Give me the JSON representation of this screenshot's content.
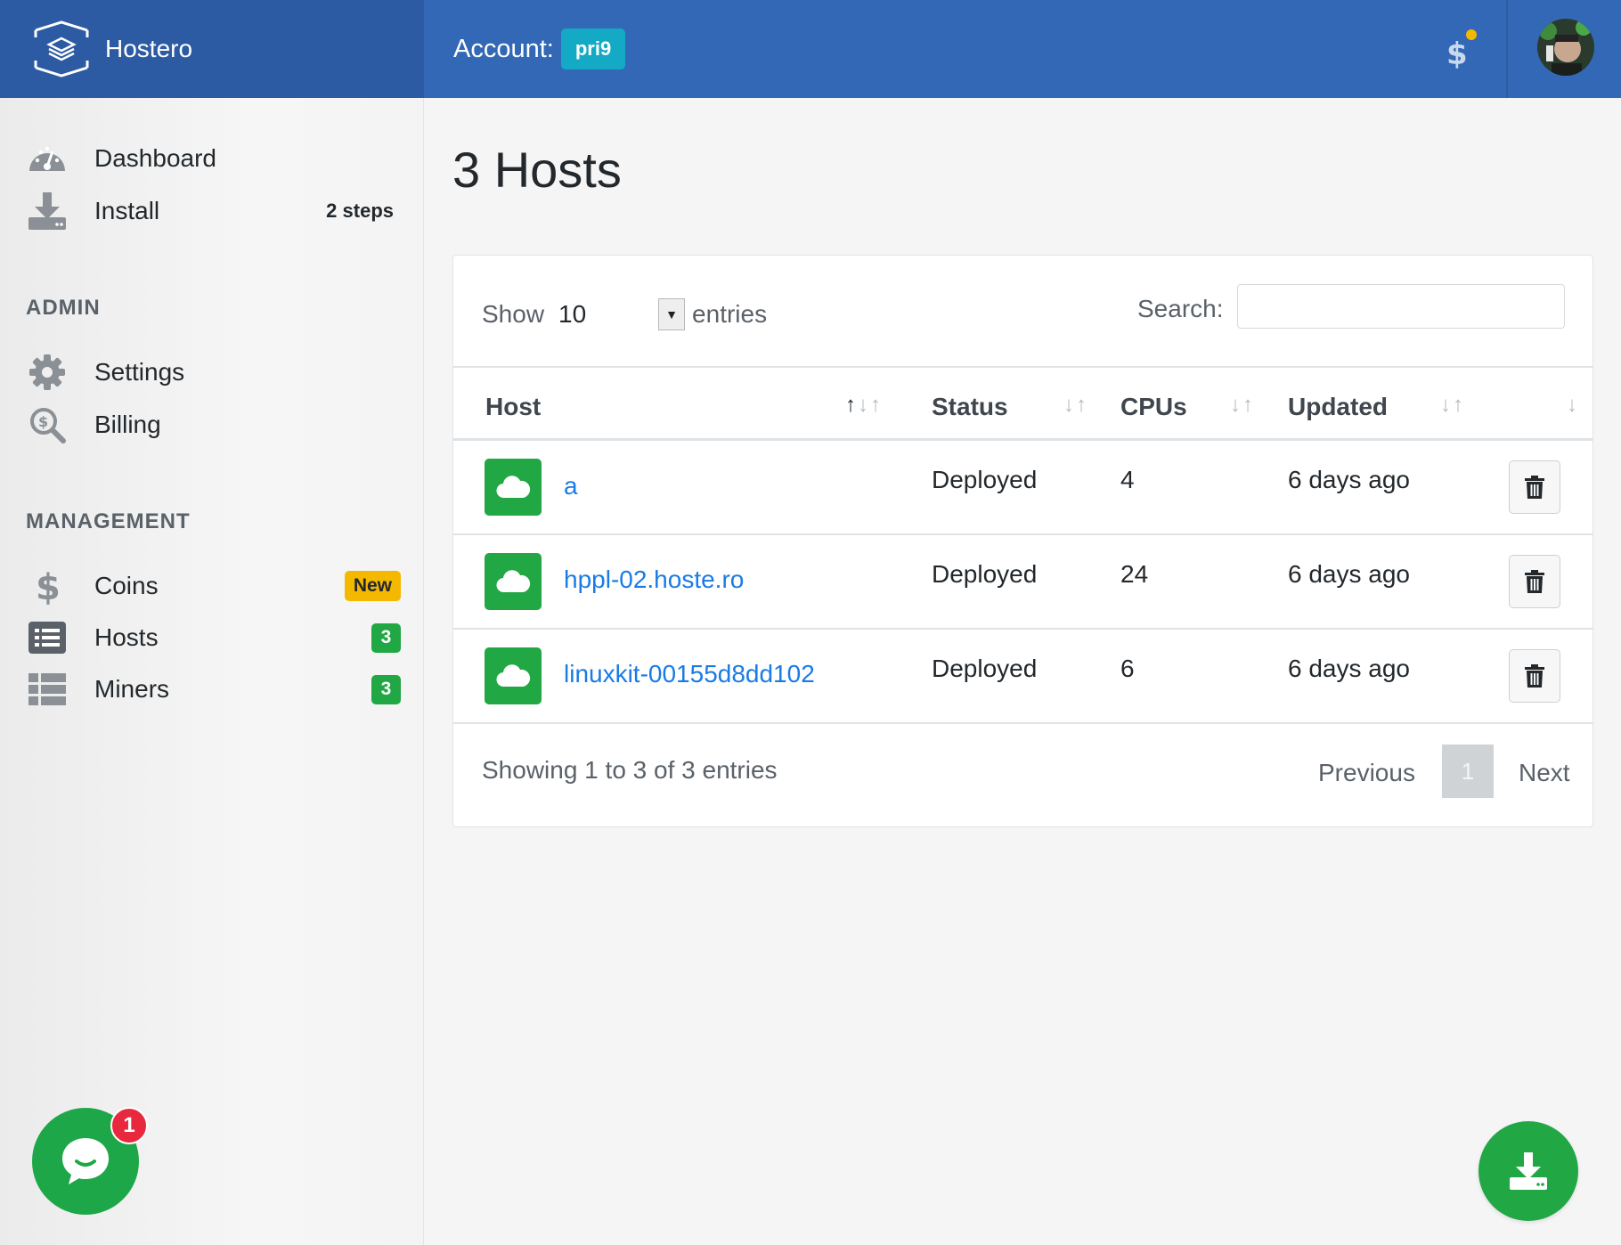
{
  "app": {
    "name": "Hostero"
  },
  "topbar": {
    "account_label": "Account:",
    "account_name": "pri9"
  },
  "sidebar": {
    "items": [
      {
        "label": "Dashboard",
        "icon": "dashboard-icon"
      },
      {
        "label": "Install",
        "icon": "download-icon",
        "extra": "2 steps"
      }
    ],
    "admin": {
      "title": "ADMIN",
      "items": [
        {
          "label": "Settings",
          "icon": "gear-icon"
        },
        {
          "label": "Billing",
          "icon": "billing-search-icon"
        }
      ]
    },
    "management": {
      "title": "MANAGEMENT",
      "items": [
        {
          "label": "Coins",
          "icon": "dollar-icon",
          "badge": "New"
        },
        {
          "label": "Hosts",
          "icon": "list-icon",
          "badge": "3"
        },
        {
          "label": "Miners",
          "icon": "th-list-icon",
          "badge": "3"
        }
      ]
    }
  },
  "main": {
    "title": "3 Hosts",
    "table": {
      "show_label": "Show",
      "show_value": "10",
      "entries_label": "entries",
      "search_label": "Search:",
      "search_value": "",
      "columns": [
        "Host",
        "Status",
        "CPUs",
        "Updated"
      ],
      "rows": [
        {
          "host": "a",
          "status": "Deployed",
          "cpus": "4",
          "updated": "6 days ago"
        },
        {
          "host": "hppl-02.hoste.ro",
          "status": "Deployed",
          "cpus": "24",
          "updated": "6 days ago"
        },
        {
          "host": "linuxkit-00155d8dd102",
          "status": "Deployed",
          "cpus": "6",
          "updated": "6 days ago"
        }
      ],
      "info": "Showing 1 to 3 of 3 entries",
      "pagination": {
        "previous": "Previous",
        "current": "1",
        "next": "Next"
      }
    }
  },
  "chat": {
    "unread": "1"
  },
  "colors": {
    "brand": "#2d5ba3",
    "topbar": "#3268b5",
    "accent": "#22a745",
    "link": "#1a7be4",
    "warning": "#f5b800",
    "danger": "#e8293d"
  }
}
